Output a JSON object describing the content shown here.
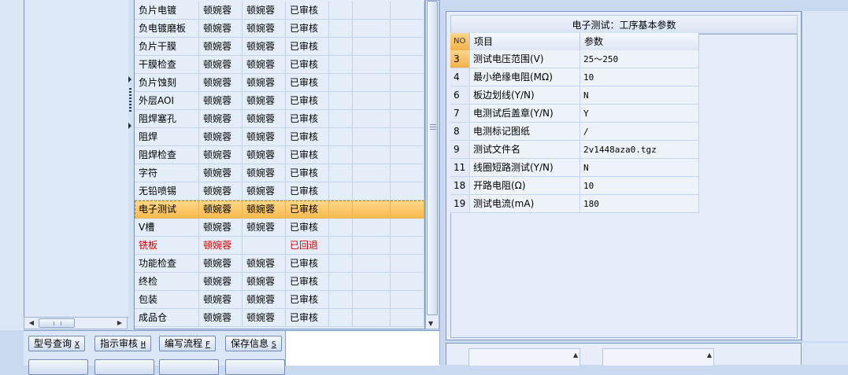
{
  "process_rows": [
    {
      "name": "负片电镀",
      "c2": "顿婉蓉",
      "c3": "顿婉蓉",
      "status": "已审核"
    },
    {
      "name": "负电镀磨板",
      "c2": "顿婉蓉",
      "c3": "顿婉蓉",
      "status": "已审核"
    },
    {
      "name": "负片干膜",
      "c2": "顿婉蓉",
      "c3": "顿婉蓉",
      "status": "已审核"
    },
    {
      "name": "干膜检查",
      "c2": "顿婉蓉",
      "c3": "顿婉蓉",
      "status": "已审核"
    },
    {
      "name": "负片蚀刻",
      "c2": "顿婉蓉",
      "c3": "顿婉蓉",
      "status": "已审核"
    },
    {
      "name": "外层AOI",
      "c2": "顿婉蓉",
      "c3": "顿婉蓉",
      "status": "已审核"
    },
    {
      "name": "阻焊塞孔",
      "c2": "顿婉蓉",
      "c3": "顿婉蓉",
      "status": "已审核"
    },
    {
      "name": "阻焊",
      "c2": "顿婉蓉",
      "c3": "顿婉蓉",
      "status": "已审核"
    },
    {
      "name": "阻焊检查",
      "c2": "顿婉蓉",
      "c3": "顿婉蓉",
      "status": "已审核"
    },
    {
      "name": "字符",
      "c2": "顿婉蓉",
      "c3": "顿婉蓉",
      "status": "已审核"
    },
    {
      "name": "无铅喷锡",
      "c2": "顿婉蓉",
      "c3": "顿婉蓉",
      "status": "已审核"
    },
    {
      "name": "电子测试",
      "c2": "顿婉蓉",
      "c3": "顿婉蓉",
      "status": "已审核",
      "selected": true
    },
    {
      "name": "V槽",
      "c2": "顿婉蓉",
      "c3": "顿婉蓉",
      "status": "已审核"
    },
    {
      "name": "铣板",
      "c2": "顿婉蓉",
      "c3": "",
      "status": "已回退",
      "rejected": true
    },
    {
      "name": "功能检查",
      "c2": "顿婉蓉",
      "c3": "顿婉蓉",
      "status": "已审核"
    },
    {
      "name": "终检",
      "c2": "顿婉蓉",
      "c3": "顿婉蓉",
      "status": "已审核"
    },
    {
      "name": "包装",
      "c2": "顿婉蓉",
      "c3": "顿婉蓉",
      "status": "已审核"
    },
    {
      "name": "成品仓",
      "c2": "顿婉蓉",
      "c3": "顿婉蓉",
      "status": "已审核"
    }
  ],
  "buttons": {
    "row1": [
      {
        "label": "型号查询",
        "key": "X"
      },
      {
        "label": "指示审核",
        "key": "H"
      },
      {
        "label": "编写流程",
        "key": "F"
      },
      {
        "label": "保存信息",
        "key": "S"
      }
    ]
  },
  "param_panel": {
    "title": "电子测试：工序基本参数",
    "headers": {
      "no": "NO",
      "item": "项目",
      "value": "参数"
    },
    "rows": [
      {
        "no": "3",
        "item": "测试电压范围(V)",
        "value": "25～250"
      },
      {
        "no": "4",
        "item": "最小绝缘电阻(MΩ)",
        "value": "10"
      },
      {
        "no": "6",
        "item": "板边划线(Y/N)",
        "value": "N"
      },
      {
        "no": "7",
        "item": "电测试后盖章(Y/N)",
        "value": "Y"
      },
      {
        "no": "8",
        "item": "电测标记图纸",
        "value": "/"
      },
      {
        "no": "9",
        "item": "测试文件名",
        "value": "2v1448aza0.tgz"
      },
      {
        "no": "11",
        "item": "线圈短路测试(Y/N)",
        "value": "N"
      },
      {
        "no": "18",
        "item": "开路电阻(Ω)",
        "value": "10"
      },
      {
        "no": "19",
        "item": "测试电流(mA)",
        "value": "180"
      }
    ]
  },
  "colors": {
    "selection": "#f7b84a",
    "rejected_text": "#d40000",
    "panel_bg": "#e7eef9"
  }
}
